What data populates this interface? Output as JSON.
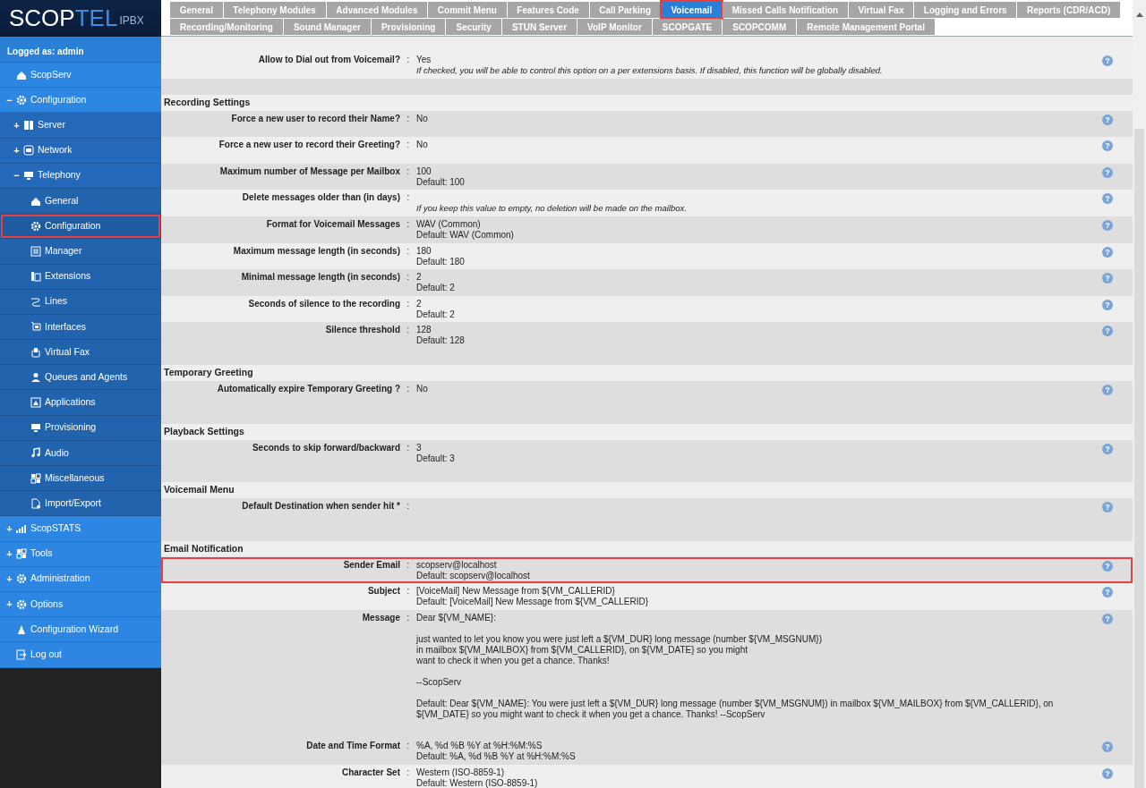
{
  "logo": {
    "part_a": "SCOP",
    "part_b": "TEL",
    "suffix": "IPBX"
  },
  "tabs": [
    [
      {
        "label": "General",
        "selected": false,
        "highlighted": false
      },
      {
        "label": "Telephony Modules",
        "selected": false,
        "highlighted": false
      },
      {
        "label": "Advanced Modules",
        "selected": false,
        "highlighted": false
      },
      {
        "label": "Commit Menu",
        "selected": false,
        "highlighted": false
      },
      {
        "label": "Features Code",
        "selected": false,
        "highlighted": false
      },
      {
        "label": "Call Parking",
        "selected": false,
        "highlighted": false
      },
      {
        "label": "Voicemail",
        "selected": true,
        "highlighted": true
      },
      {
        "label": "Missed Calls Notification",
        "selected": false,
        "highlighted": false
      },
      {
        "label": "Virtual Fax",
        "selected": false,
        "highlighted": false
      },
      {
        "label": "Logging and Errors",
        "selected": false,
        "highlighted": false
      },
      {
        "label": "Reports (CDR/ACD)",
        "selected": false,
        "highlighted": false
      }
    ],
    [
      {
        "label": "Recording/Monitoring",
        "selected": false,
        "highlighted": false
      },
      {
        "label": "Sound Manager",
        "selected": false,
        "highlighted": false
      },
      {
        "label": "Provisioning",
        "selected": false,
        "highlighted": false
      },
      {
        "label": "Security",
        "selected": false,
        "highlighted": false
      },
      {
        "label": "STUN Server",
        "selected": false,
        "highlighted": false
      },
      {
        "label": "VoIP Monitor",
        "selected": false,
        "highlighted": false
      },
      {
        "label": "SCOPGATE",
        "selected": false,
        "highlighted": false
      },
      {
        "label": "SCOPCOMM",
        "selected": false,
        "highlighted": false
      },
      {
        "label": "Remote Management Portal",
        "selected": false,
        "highlighted": false
      }
    ]
  ],
  "sidebar": {
    "logged_as": "Logged as: admin",
    "items": [
      {
        "label": "ScopServ",
        "selected": false,
        "highlighted": false
      },
      {
        "label": "Configuration",
        "toggle": "−",
        "selected": false,
        "highlighted": false,
        "children": [
          {
            "label": "Server",
            "toggle": "+",
            "selected": false,
            "highlighted": false
          },
          {
            "label": "Network",
            "toggle": "+",
            "selected": false,
            "highlighted": false
          },
          {
            "label": "Telephony",
            "toggle": "−",
            "selected": false,
            "highlighted": false,
            "children": [
              {
                "label": "General",
                "selected": false,
                "highlighted": false
              },
              {
                "label": "Configuration",
                "selected": true,
                "highlighted": true
              },
              {
                "label": "Manager",
                "selected": false,
                "highlighted": false
              },
              {
                "label": "Extensions",
                "selected": false,
                "highlighted": false
              },
              {
                "label": "Lines",
                "selected": false,
                "highlighted": false
              },
              {
                "label": "Interfaces",
                "selected": false,
                "highlighted": false
              },
              {
                "label": "Virtual Fax",
                "selected": false,
                "highlighted": false
              },
              {
                "label": "Queues and Agents",
                "selected": false,
                "highlighted": false
              },
              {
                "label": "Applications",
                "selected": false,
                "highlighted": false
              },
              {
                "label": "Provisioning",
                "selected": false,
                "highlighted": false
              },
              {
                "label": "Audio",
                "selected": false,
                "highlighted": false
              },
              {
                "label": "Miscellaneous",
                "selected": false,
                "highlighted": false
              },
              {
                "label": "Import/Export",
                "selected": false,
                "highlighted": false
              }
            ]
          }
        ]
      },
      {
        "label": "ScopSTATS",
        "toggle": "+",
        "selected": false,
        "highlighted": false
      },
      {
        "label": "Tools",
        "toggle": "+",
        "selected": false,
        "highlighted": false
      },
      {
        "label": "Administration",
        "toggle": "+",
        "selected": false,
        "highlighted": false
      },
      {
        "label": "Options",
        "toggle": "+",
        "selected": false,
        "highlighted": false
      },
      {
        "label": "Configuration Wizard",
        "selected": false,
        "highlighted": false
      },
      {
        "label": "Log out",
        "selected": false,
        "highlighted": false
      }
    ]
  },
  "sections": [
    {
      "rows": [
        {
          "label": "Allow to Dial out from Voicemail?",
          "value": "Yes",
          "note": "If checked, you will be able to control this option on a per extensions basis. If disabled, this function will be globally disabled.",
          "help": "?",
          "highlighted": false
        }
      ]
    },
    {
      "title": "Recording Settings",
      "rows": [
        {
          "label": "Force a new user to record their Name?",
          "value": "No",
          "help": "?",
          "highlighted": false
        },
        {
          "label": "Force a new user to record their Greeting?",
          "value": "No",
          "help": "?",
          "highlighted": false
        },
        {
          "label": "Maximum number of Message per Mailbox",
          "value": "100",
          "default": "Default: 100",
          "help": "?",
          "highlighted": false
        },
        {
          "label": "Delete messages older than (in days)",
          "note": "If you keep this value to empty, no deletion will be made on the mailbox.",
          "help": "?",
          "highlighted": false
        },
        {
          "label": "Format for Voicemail Messages",
          "value": "WAV (Common)",
          "default": "Default: WAV (Common)",
          "help": "?",
          "highlighted": false
        },
        {
          "label": "Maximum message length (in seconds)",
          "value": "180",
          "default": "Default: 180",
          "help": "?",
          "highlighted": false
        },
        {
          "label": "Minimal message length (in seconds)",
          "value": "2",
          "default": "Default: 2",
          "help": "?",
          "highlighted": false
        },
        {
          "label": "Seconds of silence to the recording",
          "value": "2",
          "default": "Default: 2",
          "help": "?",
          "highlighted": false
        },
        {
          "label": "Silence threshold",
          "value": "128",
          "default": "Default: 128",
          "help": "?",
          "highlighted": false
        }
      ]
    },
    {
      "title": "Temporary Greeting",
      "rows": [
        {
          "label": "Automatically expire Temporary Greeting ?",
          "value": "No",
          "help": "?",
          "highlighted": false
        }
      ]
    },
    {
      "title": "Playback Settings",
      "rows": [
        {
          "label": "Seconds to skip forward/backward",
          "value": "3",
          "default": "Default: 3",
          "help": "?",
          "highlighted": false
        }
      ]
    },
    {
      "title": "Voicemail Menu",
      "rows": [
        {
          "label": "Default Destination when sender hit *",
          "help": "?",
          "highlighted": false
        }
      ]
    },
    {
      "title": "Email Notification",
      "rows": [
        {
          "label": "Sender Email",
          "value": "scopserv@localhost",
          "default": "Default: scopserv@localhost",
          "help": "?",
          "highlighted": true
        },
        {
          "label": "Subject",
          "value": "[VoiceMail] New Message from ${VM_CALLERID}",
          "default": "Default: [VoiceMail] New Message from ${VM_CALLERID}",
          "help": "?",
          "highlighted": false
        },
        {
          "label": "Message",
          "paragraphs": [
            [
              "Dear ${VM_NAME}:"
            ],
            [
              "just wanted to let you know you were just left a ${VM_DUR} long message (number ${VM_MSGNUM})",
              "in mailbox ${VM_MAILBOX} from ${VM_CALLERID}, on ${VM_DATE} so you might",
              "want to check it when you get a chance. Thanks!"
            ],
            [
              "--ScopServ"
            ]
          ],
          "default": "Default: Dear ${VM_NAME}: You were just left a ${VM_DUR} long message (number ${VM_MSGNUM}) in mailbox ${VM_MAILBOX} from ${VM_CALLERID}, on ${VM_DATE} so you might want to check it when you get a chance. Thanks! --ScopServ",
          "help": "?",
          "highlighted": false
        }
      ]
    },
    {
      "rows": [
        {
          "label": "Date and Time Format",
          "value": "%A, %d %B %Y at %H:%M:%S",
          "default": "Default: %A, %d %B %Y at %H:%M:%S",
          "help": "?",
          "highlighted": false
        },
        {
          "label": "Character Set",
          "value": "Western (ISO-8859-1)",
          "default": "Default: Western (ISO-8859-1)",
          "help": "?",
          "highlighted": false
        }
      ]
    }
  ],
  "colon": ":"
}
